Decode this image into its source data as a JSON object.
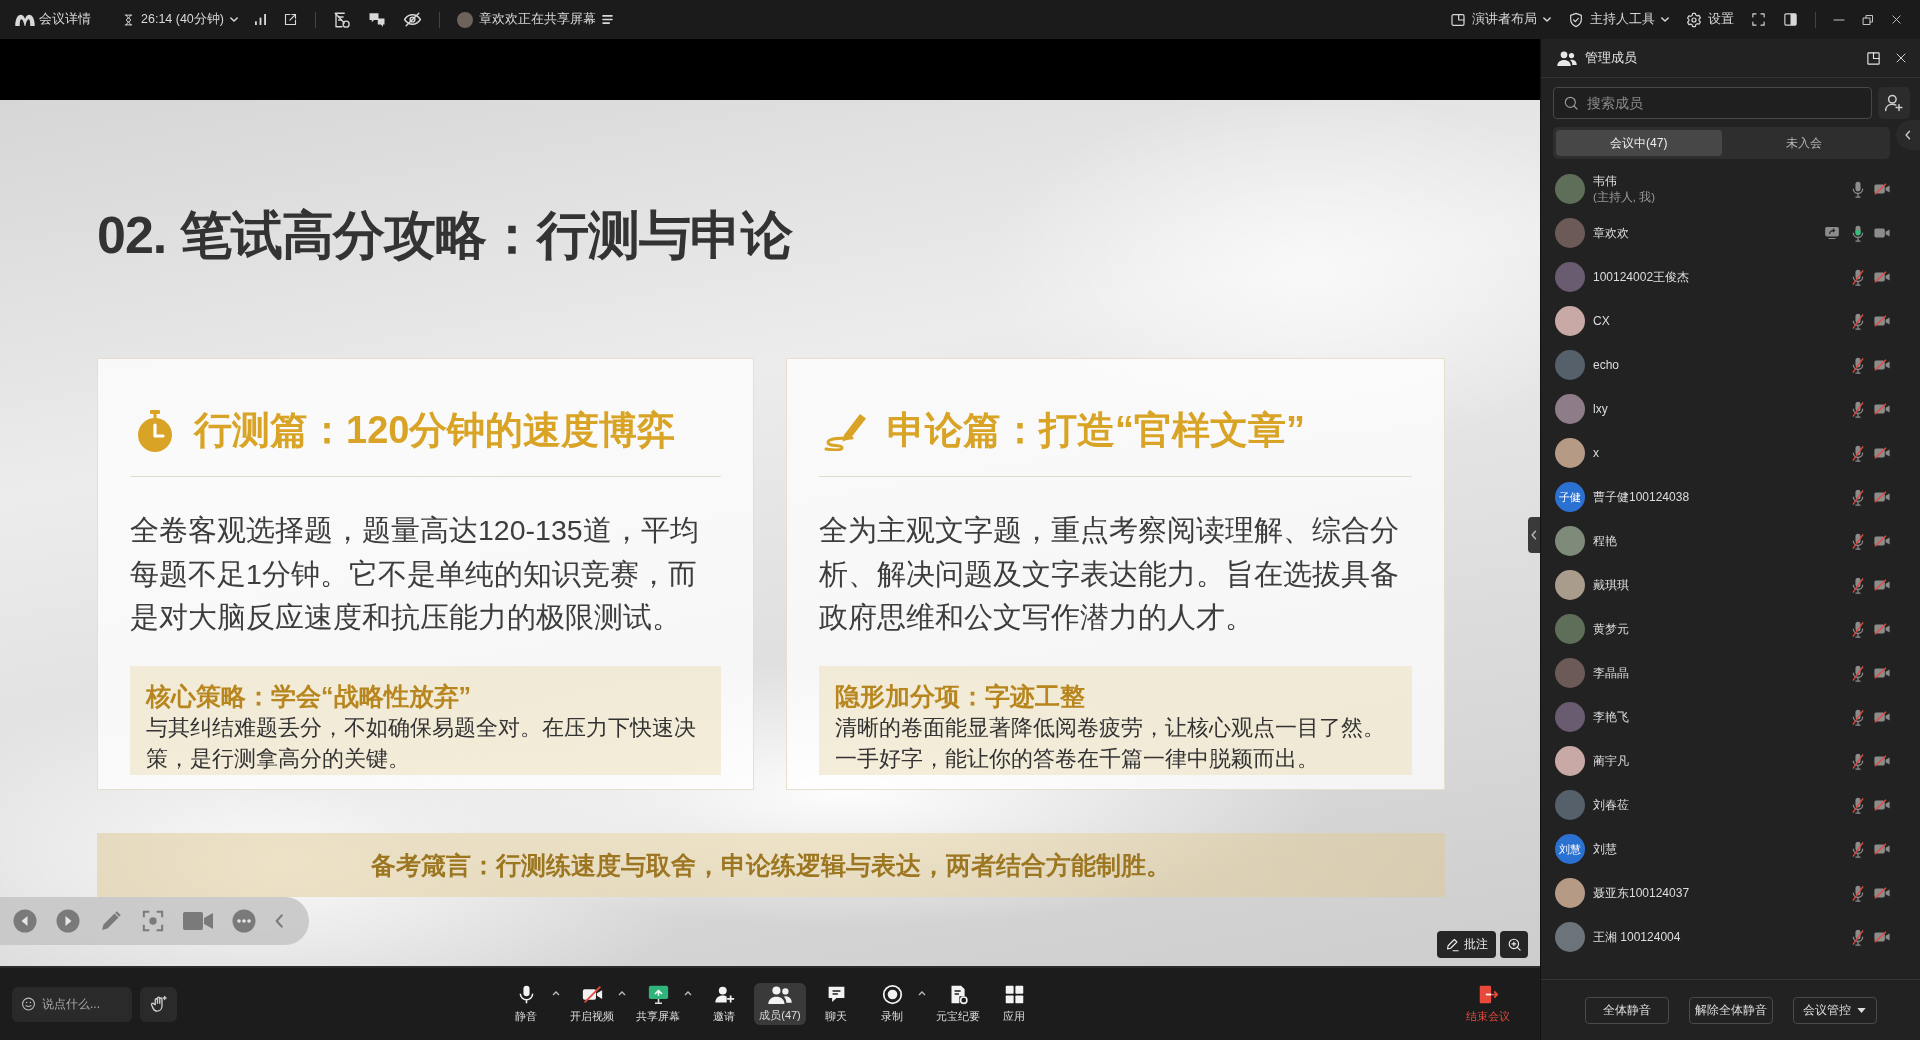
{
  "top_bar": {
    "meeting_info": "会议详情",
    "timer": "26:14 (40分钟)",
    "sharing_notice": "章欢欢正在共享屏幕",
    "layout_button": "演讲者布局",
    "host_tools_button": "主持人工具",
    "settings_button": "设置"
  },
  "slide": {
    "title": "02. 笔试高分攻略：行测与申论",
    "cards": [
      {
        "kind": "stopwatch",
        "heading": "行测篇：120分钟的速度博弈",
        "body": "全卷客观选择题，题量高达120-135道，平均每题不足1分钟。它不是单纯的知识竞赛，而是对大脑反应速度和抗压能力的极限测试。",
        "tip_title": "核心策略：学会“战略性放弃”",
        "tip_body": "与其纠结难题丢分，不如确保易题全对。在压力下快速决策，是行测拿高分的关键。"
      },
      {
        "kind": "pen",
        "heading": "申论篇：打造“官样文章”",
        "body": "全为主观文字题，重点考察阅读理解、综合分析、解决问题及文字表达能力。旨在选拔具备政府思维和公文写作潜力的人才。",
        "tip_title": "隐形加分项：字迹工整",
        "tip_body": "清晰的卷面能显著降低阅卷疲劳，让核心观点一目了然。一手好字，能让你的答卷在千篇一律中脱颖而出。"
      }
    ],
    "banner": "备考箴言：行测练速度与取舍，申论练逻辑与表达，两者结合方能制胜。"
  },
  "annotate_button": "批注",
  "toolbar": {
    "chat": {
      "placeholder": "说点什么..."
    },
    "buttons": [
      {
        "kind": "mic",
        "label": "静音",
        "menu": true,
        "selected": false,
        "off": false
      },
      {
        "kind": "camera",
        "label": "开启视频",
        "menu": true,
        "selected": false,
        "off": true
      },
      {
        "kind": "share",
        "label": "共享屏幕",
        "menu": true,
        "selected": false,
        "off": false
      },
      {
        "kind": "invite",
        "label": "邀请",
        "menu": false,
        "selected": false,
        "off": false
      },
      {
        "kind": "members",
        "label": "成员(47)",
        "menu": false,
        "selected": true,
        "off": false
      },
      {
        "kind": "chat",
        "label": "聊天",
        "menu": false,
        "selected": false,
        "off": false
      },
      {
        "kind": "record",
        "label": "录制",
        "menu": true,
        "selected": false,
        "off": false
      },
      {
        "kind": "summary",
        "label": "元宝纪要",
        "menu": false,
        "selected": false,
        "off": false
      },
      {
        "kind": "apps",
        "label": "应用",
        "menu": false,
        "selected": false,
        "off": false
      }
    ],
    "end_button": "结束会议"
  },
  "members_panel": {
    "title": "管理成员",
    "search": {
      "placeholder": "搜索成员"
    },
    "tabs": [
      {
        "label": "会议中(47)",
        "selected": true
      },
      {
        "label": "未入会",
        "selected": false
      }
    ],
    "members": [
      {
        "name": "韦伟",
        "role": "(主持人, 我)",
        "avatar": {
          "kind": "photo"
        },
        "sharing": false,
        "mic_muted": false,
        "speaking": false,
        "video_on": false
      },
      {
        "name": "章欢欢",
        "avatar": {
          "kind": "photo"
        },
        "sharing": true,
        "mic_muted": false,
        "speaking": true,
        "video_on": true
      },
      {
        "name": "100124002王俊杰",
        "avatar": {
          "kind": "photo"
        },
        "sharing": false,
        "mic_muted": true,
        "speaking": false,
        "video_on": false
      },
      {
        "name": "CX",
        "avatar": {
          "kind": "photo"
        },
        "sharing": false,
        "mic_muted": true,
        "speaking": false,
        "video_on": false
      },
      {
        "name": "echo",
        "avatar": {
          "kind": "photo"
        },
        "sharing": false,
        "mic_muted": true,
        "speaking": false,
        "video_on": false
      },
      {
        "name": "lxy",
        "avatar": {
          "kind": "photo"
        },
        "sharing": false,
        "mic_muted": true,
        "speaking": false,
        "video_on": false
      },
      {
        "name": "x",
        "avatar": {
          "kind": "photo"
        },
        "sharing": false,
        "mic_muted": true,
        "speaking": false,
        "video_on": false
      },
      {
        "name": "曹子健100124038",
        "avatar": {
          "kind": "initials",
          "text": "子健"
        },
        "sharing": false,
        "mic_muted": true,
        "speaking": false,
        "video_on": false
      },
      {
        "name": "程艳",
        "avatar": {
          "kind": "photo"
        },
        "sharing": false,
        "mic_muted": true,
        "speaking": false,
        "video_on": false
      },
      {
        "name": "戴琪琪",
        "avatar": {
          "kind": "photo"
        },
        "sharing": false,
        "mic_muted": true,
        "speaking": false,
        "video_on": false
      },
      {
        "name": "黄梦元",
        "avatar": {
          "kind": "photo"
        },
        "sharing": false,
        "mic_muted": true,
        "speaking": false,
        "video_on": false
      },
      {
        "name": "李晶晶",
        "avatar": {
          "kind": "photo"
        },
        "sharing": false,
        "mic_muted": true,
        "speaking": false,
        "video_on": false
      },
      {
        "name": "李艳飞",
        "avatar": {
          "kind": "photo"
        },
        "sharing": false,
        "mic_muted": true,
        "speaking": false,
        "video_on": false
      },
      {
        "name": "蔺宇凡",
        "avatar": {
          "kind": "photo"
        },
        "sharing": false,
        "mic_muted": true,
        "speaking": false,
        "video_on": false
      },
      {
        "name": "刘春莅",
        "avatar": {
          "kind": "photo"
        },
        "sharing": false,
        "mic_muted": true,
        "speaking": false,
        "video_on": false
      },
      {
        "name": "刘慧",
        "avatar": {
          "kind": "initials",
          "text": "刘慧"
        },
        "sharing": false,
        "mic_muted": true,
        "speaking": false,
        "video_on": false
      },
      {
        "name": "聂亚东100124037",
        "avatar": {
          "kind": "photo"
        },
        "sharing": false,
        "mic_muted": true,
        "speaking": false,
        "video_on": false
      },
      {
        "name": "王湘 100124004",
        "avatar": {
          "kind": "photo"
        },
        "sharing": false,
        "mic_muted": true,
        "speaking": false,
        "video_on": false
      }
    ],
    "buttons": [
      {
        "label": "全体静音",
        "menu": false
      },
      {
        "label": "解除全体静音",
        "menu": false
      },
      {
        "label": "会议管控",
        "menu": true
      }
    ]
  }
}
